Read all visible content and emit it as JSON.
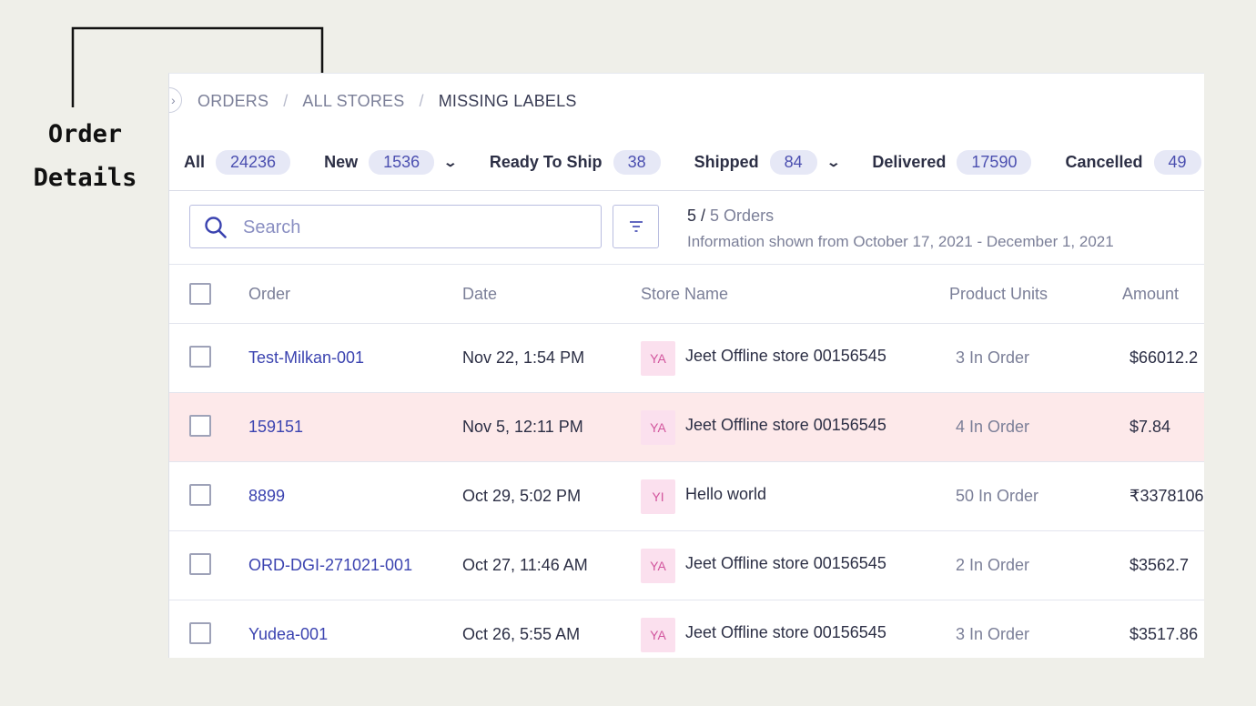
{
  "annotation": {
    "line1": "Order",
    "line2": "Details"
  },
  "breadcrumb": [
    "ORDERS",
    "ALL STORES",
    "MISSING LABELS"
  ],
  "breadcrumb_separator": "/",
  "tabs": [
    {
      "label": "All",
      "count": "24236",
      "dropdown": false
    },
    {
      "label": "New",
      "count": "1536",
      "dropdown": true
    },
    {
      "label": "Ready To Ship",
      "count": "38",
      "dropdown": false
    },
    {
      "label": "Shipped",
      "count": "84",
      "dropdown": true
    },
    {
      "label": "Delivered",
      "count": "17590",
      "dropdown": false
    },
    {
      "label": "Cancelled",
      "count": "49",
      "dropdown": false
    }
  ],
  "search": {
    "placeholder": "Search",
    "value": ""
  },
  "summary": {
    "shown": "5",
    "total": "5 Orders",
    "info": "Information shown from October 17, 2021 - December 1, 2021"
  },
  "columns": {
    "order": "Order",
    "date": "Date",
    "store": "Store Name",
    "units": "Product Units",
    "amount": "Amount"
  },
  "rows": [
    {
      "order": "Test-Milkan-001",
      "date": "Nov 22, 1:54 PM",
      "avatar": "YA",
      "store": "Jeet Offline store 00156545",
      "units": "3 In Order",
      "amount": "$66012.2",
      "flagged": false
    },
    {
      "order": "159151",
      "date": "Nov 5, 12:11 PM",
      "avatar": "YA",
      "store": "Jeet Offline store 00156545",
      "units": "4 In Order",
      "amount": "$7.84",
      "flagged": true
    },
    {
      "order": "8899",
      "date": "Oct 29, 5:02 PM",
      "avatar": "YI",
      "store": "Hello world",
      "units": "50 In Order",
      "amount": "₹3378106",
      "flagged": false
    },
    {
      "order": "ORD-DGI-271021-001",
      "date": "Oct 27, 11:46 AM",
      "avatar": "YA",
      "store": "Jeet Offline store 00156545",
      "units": "2 In Order",
      "amount": "$3562.7",
      "flagged": false
    },
    {
      "order": "Yudea-001",
      "date": "Oct 26, 5:55 AM",
      "avatar": "YA",
      "store": "Jeet Offline store 00156545",
      "units": "3 In Order",
      "amount": "$3517.86",
      "flagged": false
    }
  ],
  "icons": {
    "search": "search-icon",
    "filter": "filter-icon",
    "chevron": "chevron-down-icon",
    "collapse": "chevron-right-icon"
  },
  "colors": {
    "accent": "#3b43b0",
    "flagged_row": "#fde9ea",
    "avatar_bg": "#fbe0ee",
    "avatar_text": "#d2549d"
  }
}
